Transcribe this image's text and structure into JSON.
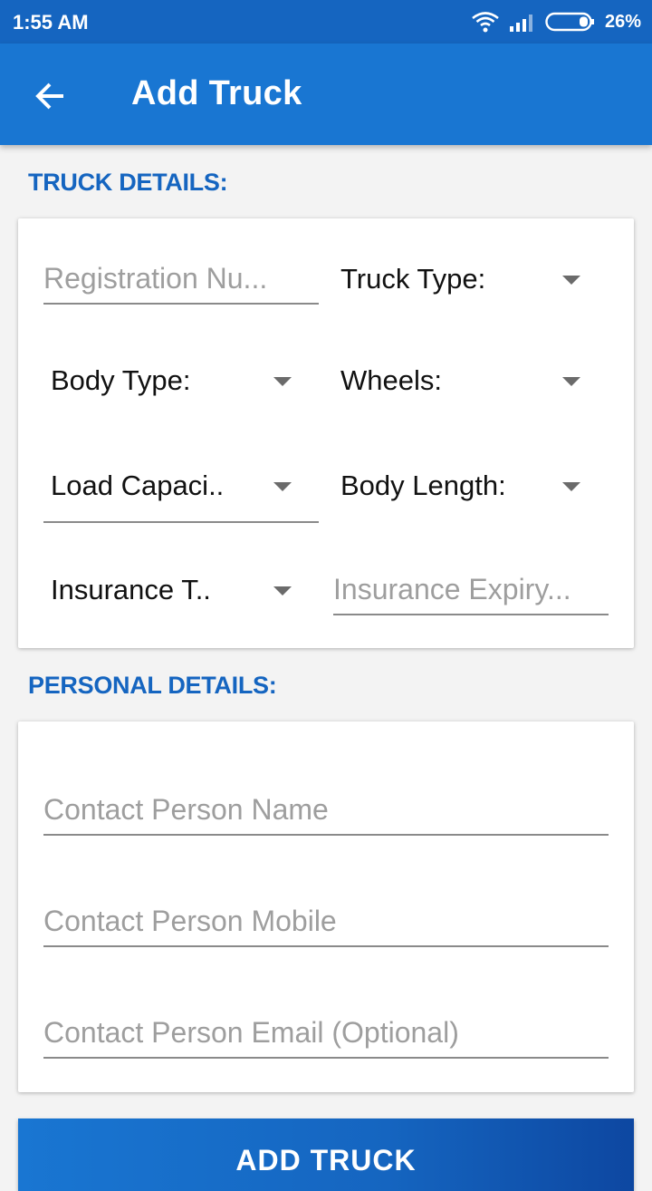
{
  "status_bar": {
    "time": "1:55 AM",
    "battery": "26%"
  },
  "app_bar": {
    "title": "Add Truck"
  },
  "truck_section": {
    "title": "TRUCK DETAILS:",
    "registration_placeholder": "Registration Nu...",
    "truck_type_label": "Truck Type:",
    "body_type_label": "Body Type:",
    "wheels_label": "Wheels:",
    "load_capacity_label": "Load Capaci..",
    "body_length_label": "Body Length:",
    "insurance_type_label": "Insurance T..",
    "insurance_expiry_placeholder": "Insurance Expiry..."
  },
  "personal_section": {
    "title": "PERSONAL DETAILS:",
    "name_placeholder": "Contact Person Name",
    "mobile_placeholder": "Contact Person Mobile",
    "email_placeholder": "Contact Person Email (Optional)"
  },
  "actions": {
    "add_truck_label": "ADD TRUCK"
  },
  "colors": {
    "primary": "#1976d2",
    "primary_dark": "#1565c0",
    "section_title": "#1565c0"
  },
  "icons": [
    "back-arrow-icon",
    "wifi-icon",
    "signal-icon",
    "battery-icon",
    "dropdown-arrow-icon"
  ]
}
